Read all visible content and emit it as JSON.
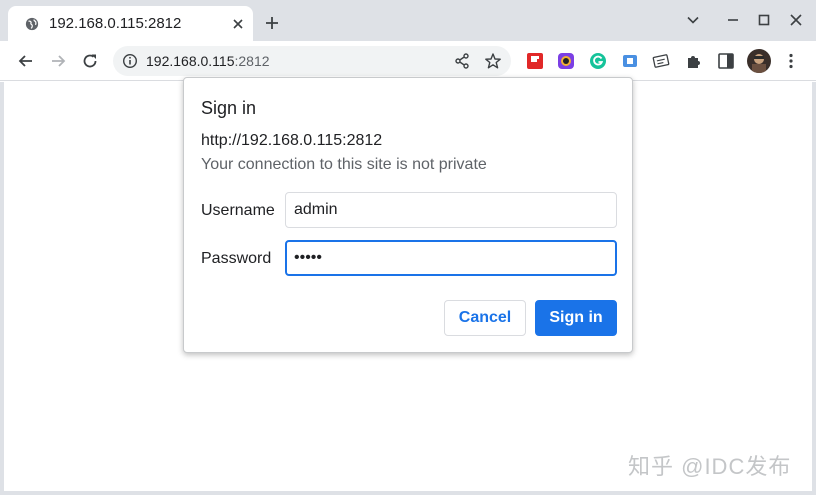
{
  "tab": {
    "title": "192.168.0.115:2812"
  },
  "omnibox": {
    "host": "192.168.0.115",
    "port": ":2812"
  },
  "dialog": {
    "title": "Sign in",
    "url": "http://192.168.0.115:2812",
    "warning": "Your connection to this site is not private",
    "username_label": "Username",
    "username_value": "admin",
    "password_label": "Password",
    "password_value": "•••••",
    "cancel_label": "Cancel",
    "signin_label": "Sign in"
  },
  "extensions": [
    "flipboard-icon",
    "camera-extension-icon",
    "grammarly-icon",
    "translate-extension-icon",
    "note-extension-icon",
    "extensions-puzzle-icon",
    "side-panel-icon"
  ],
  "watermark": "知乎 @IDC发布",
  "colors": {
    "accent": "#1a73e8",
    "tabstrip": "#dee1e6",
    "omnibox": "#f1f3f4"
  }
}
